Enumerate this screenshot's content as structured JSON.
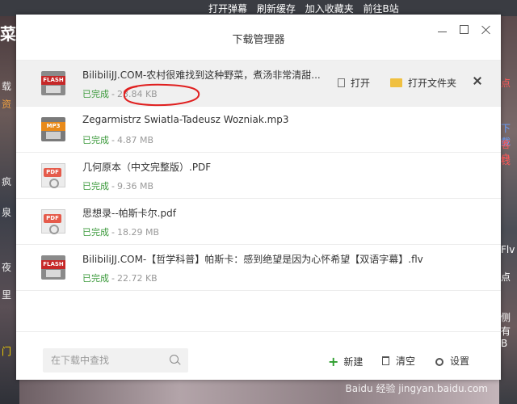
{
  "background": {
    "top_links": [
      "打开弹幕",
      "刷新缓存",
      "加入收藏夹",
      "前往B站"
    ],
    "left_text": [
      "菜",
      "载",
      "资",
      "疯",
      "泉",
      "夜",
      "里",
      "门"
    ],
    "right_text": [
      "点",
      "下载",
      "客户",
      "钱",
      "Flv",
      "点",
      "侧有",
      "B"
    ],
    "watermark": "Baidu 经验 jingyan.baidu.com"
  },
  "dialog": {
    "title": "下载管理器",
    "controls": {
      "minimize": "minimize",
      "maximize": "maximize",
      "close": "close"
    }
  },
  "files": [
    {
      "icon": "flash-file-icon",
      "icon_tag": "FLASH",
      "name": "BilibiliJJ.COM-农村很难找到这种野菜，煮汤非常清甜...",
      "status": "已完成",
      "size": "23.84 KB",
      "selected": true,
      "actions": {
        "open": "打开",
        "open_folder": "打开文件夹"
      }
    },
    {
      "icon": "mp3-file-icon",
      "icon_tag": "MP3",
      "name": "Zegarmistrz Swiatla-Tadeusz Wozniak.mp3",
      "status": "已完成",
      "size": "4.87 MB"
    },
    {
      "icon": "pdf-file-icon",
      "icon_tag": "PDF",
      "name": "几何原本（中文完整版）.PDF",
      "status": "已完成",
      "size": "9.36 MB"
    },
    {
      "icon": "pdf-file-icon",
      "icon_tag": "PDF",
      "name": "思想录--帕斯卡尔.pdf",
      "status": "已完成",
      "size": "18.29 MB"
    },
    {
      "icon": "flash-file-icon",
      "icon_tag": "FLASH",
      "name": "BilibiliJJ.COM-【哲学科普】帕斯卡：感到绝望是因为心怀希望【双语字幕】.flv",
      "status": "已完成",
      "size": "22.72 KB"
    }
  ],
  "separator": "-",
  "annotation": {
    "color": "#e02020"
  },
  "footer": {
    "search_placeholder": "在下载中查找",
    "new_label": "新建",
    "clear_label": "清空",
    "settings_label": "设置"
  },
  "colors": {
    "status_done": "#3c9a3c",
    "accent_new": "#2e9e2e",
    "folder": "#f0c040"
  }
}
